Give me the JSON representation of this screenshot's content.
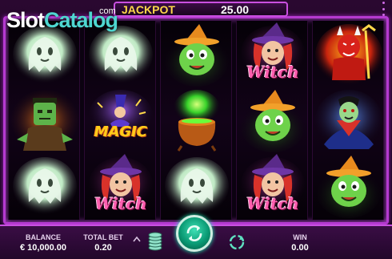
{
  "watermark": {
    "word1": "Slot",
    "word2": "Catalog",
    "suffix": "com"
  },
  "jackpot": {
    "label": "JACKPOT",
    "value": "25.00"
  },
  "reels": [
    [
      "ghost",
      "frankenstein",
      "ghost"
    ],
    [
      "ghost",
      "wizard-magic",
      "witch-purple"
    ],
    [
      "witch-green",
      "cauldron",
      "ghost"
    ],
    [
      "witch-purple",
      "witch-green",
      "witch-purple"
    ],
    [
      "devil",
      "vampire",
      "witch-green"
    ]
  ],
  "symbol_text": {
    "witch": "Witch",
    "magic": "MAGIC"
  },
  "bottom": {
    "balance_label": "BALANCE",
    "balance_value": "€ 10,000.00",
    "totalbet_label": "TOTAL BET",
    "totalbet_value": "0.20",
    "win_label": "WIN",
    "win_value": "0.00"
  },
  "controls": {
    "spin_icon": "spin-arrows-icon",
    "autoplay_icon": "autoplay-icon",
    "bet_icon": "coin-stack-icon",
    "bet_up_icon": "chevron-up-icon",
    "menu_icon": "menu-dots-icon"
  },
  "colors": {
    "accent": "#c94fe0",
    "jackpot": "#ffd84a",
    "spin": "#0a9a74"
  }
}
